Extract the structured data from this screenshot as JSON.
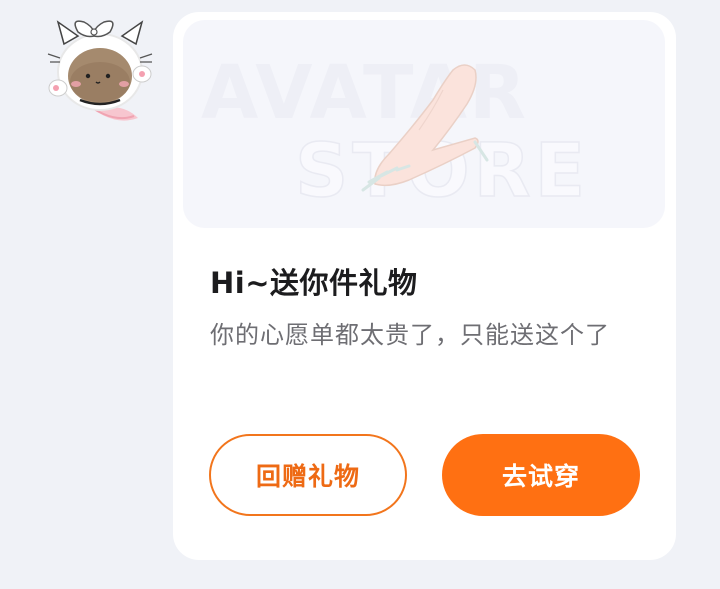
{
  "sender": {
    "avatar_icon": "cat-bear-sticker-avatar"
  },
  "card": {
    "banner": {
      "watermark_line1": "AVATAR",
      "watermark_line2": "STORE",
      "item_icon": "hand-with-long-nails-icon"
    },
    "title": "Hi~送你件礼物",
    "description": "你的心愿单都太贵了，只能送这个了",
    "buttons": {
      "return_gift": "回赠礼物",
      "try_on": "去试穿"
    }
  },
  "colors": {
    "accent": "#ff7012",
    "outline_accent": "#f2751c",
    "card_bg": "#ffffff",
    "page_bg": "#f0f2f7"
  }
}
